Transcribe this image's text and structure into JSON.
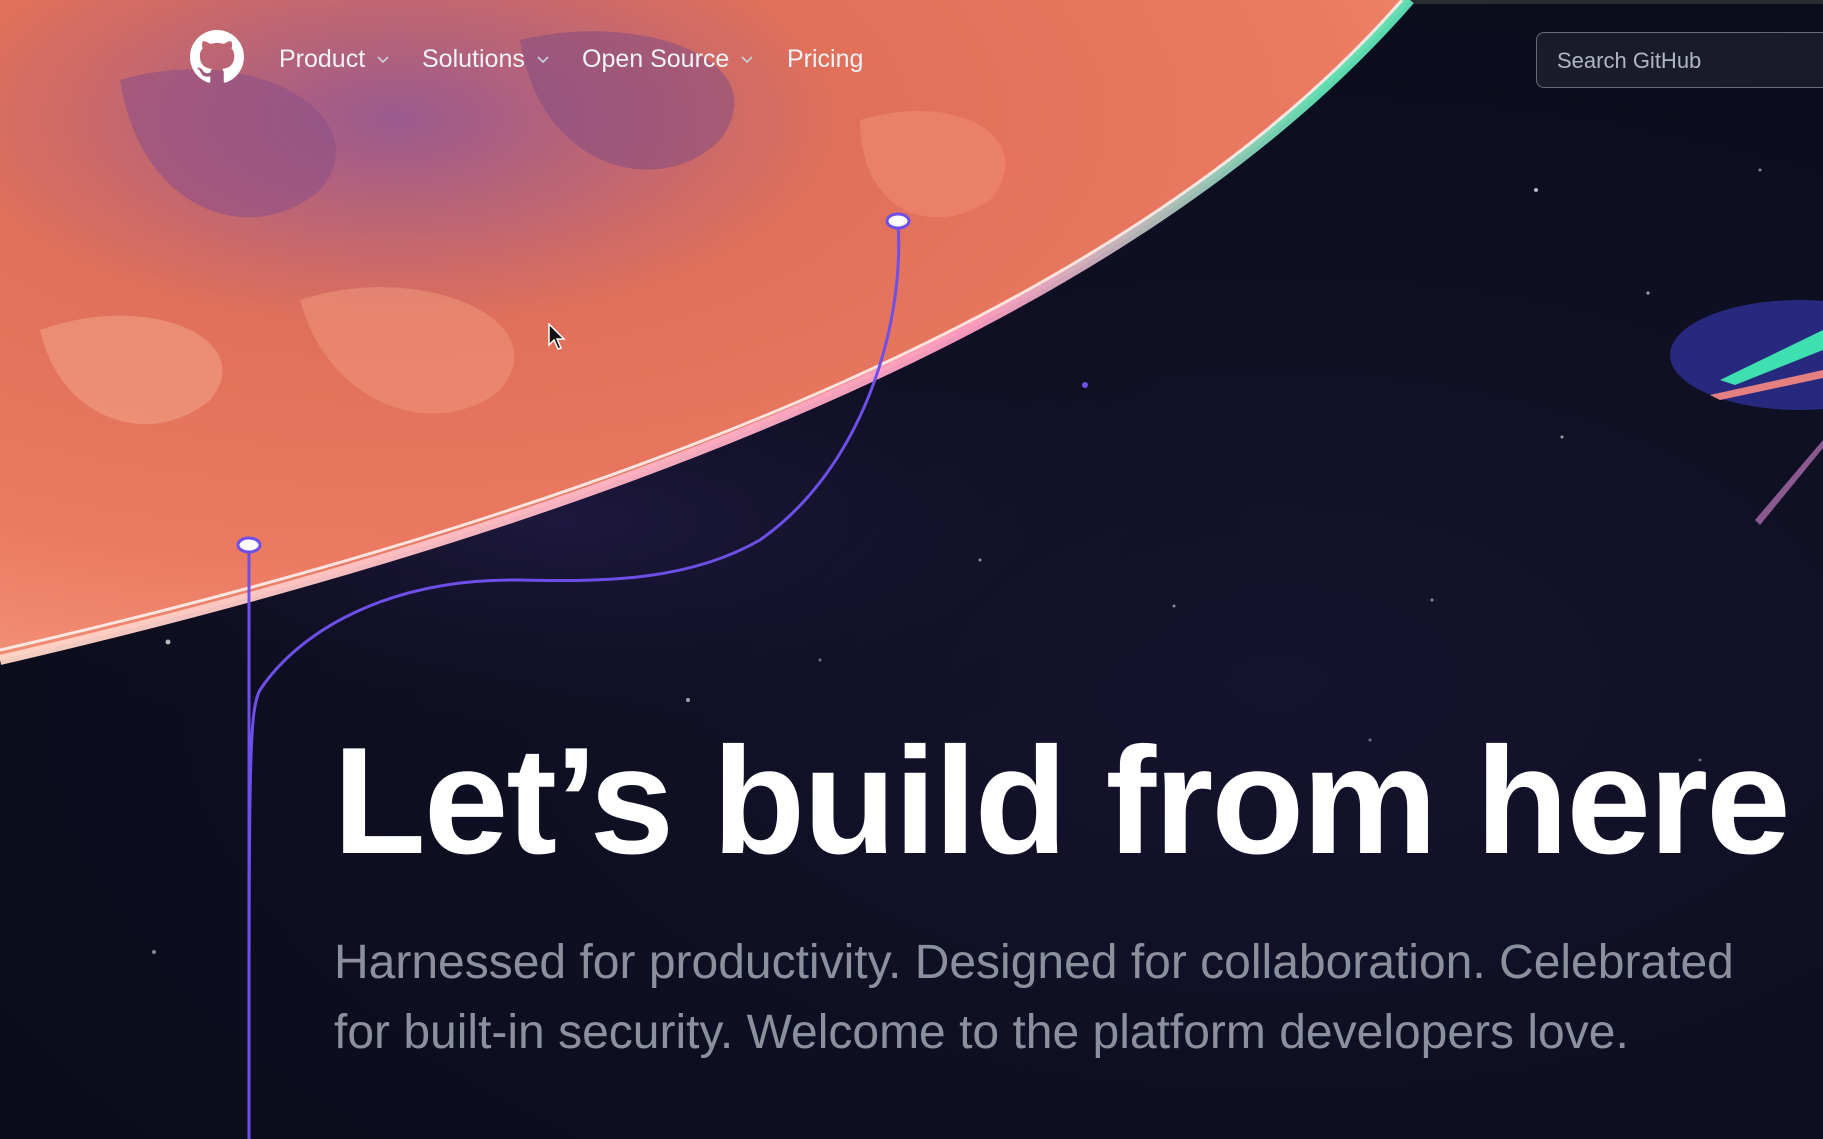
{
  "nav": {
    "logo_icon": "github-mark-icon",
    "items": [
      {
        "label": "Product",
        "has_dropdown": true
      },
      {
        "label": "Solutions",
        "has_dropdown": true
      },
      {
        "label": "Open Source",
        "has_dropdown": true
      },
      {
        "label": "Pricing",
        "has_dropdown": false
      }
    ],
    "search": {
      "placeholder": "Search GitHub"
    }
  },
  "hero": {
    "headline": "Let’s build from here",
    "subhead": "Harnessed for productivity. Designed for collaboration. Celebrated for built-in security. Welcome to the platform developers love."
  },
  "colors": {
    "background": "#0d1117",
    "planet": "#e46a52",
    "planet_glow": "#ff8fb0",
    "line_accent": "#6e4fe8",
    "text_primary": "#ffffff",
    "text_muted": "#8b919c"
  }
}
